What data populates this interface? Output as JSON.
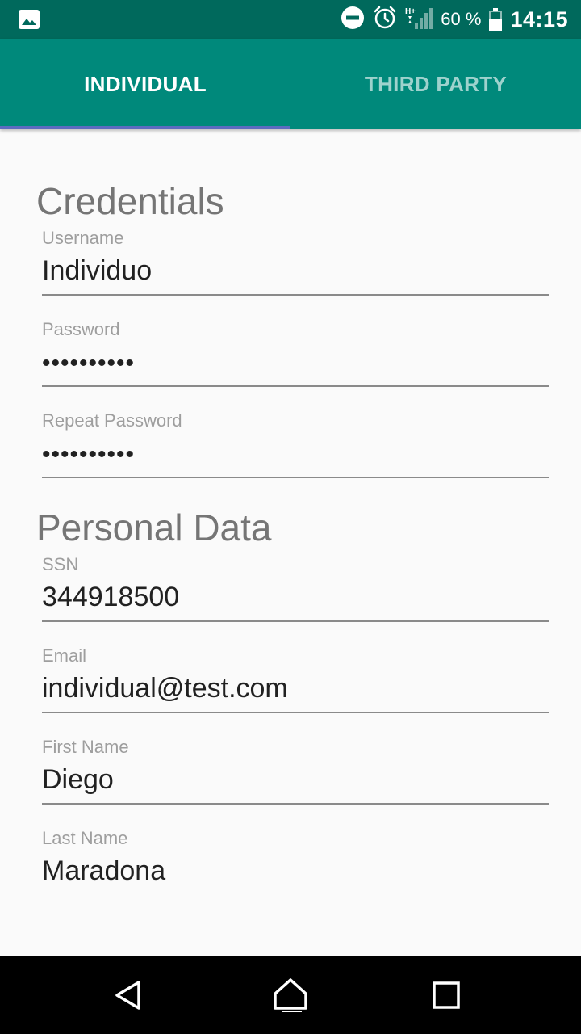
{
  "status_bar": {
    "icons": [
      "image-icon",
      "do-not-disturb-icon",
      "alarm-icon",
      "signal-hplus-icon",
      "battery-icon"
    ],
    "battery_percent": "60 %",
    "time": "14:15"
  },
  "tabs": [
    {
      "label": "INDIVIDUAL",
      "selected": true
    },
    {
      "label": "THIRD PARTY",
      "selected": false
    }
  ],
  "credentials": {
    "title": "Credentials",
    "username_label": "Username",
    "username_value": "Individuo",
    "password_label": "Password",
    "password_value": "••••••••••",
    "repeat_password_label": "Repeat Password",
    "repeat_password_value": "••••••••••"
  },
  "personal": {
    "title": "Personal Data",
    "ssn_label": "SSN",
    "ssn_value": "344918500",
    "email_label": "Email",
    "email_value": "individual@test.com",
    "first_name_label": "First Name",
    "first_name_value": "Diego",
    "last_name_label": "Last Name",
    "last_name_value": "Maradona"
  },
  "colors": {
    "status_bar": "#00695c",
    "app_bar": "#00897b",
    "tab_indicator": "#5c6bc0",
    "background": "#fafafa"
  },
  "nav_bar": {
    "icons": [
      "back-icon",
      "home-icon",
      "recents-icon"
    ]
  }
}
